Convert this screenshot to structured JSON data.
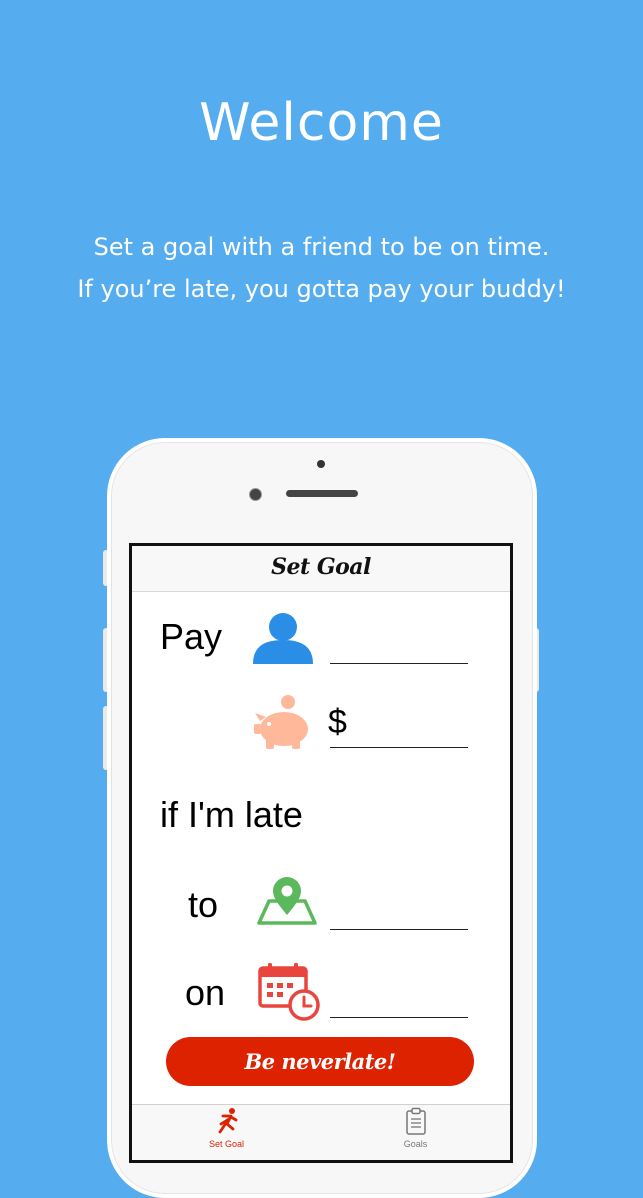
{
  "headline": "Welcome",
  "subtitle": {
    "line1": "Set a goal with a friend to be on time.",
    "line2": "If you’re late, you gotta pay your buddy!"
  },
  "app": {
    "nav_title": "Set Goal",
    "form": {
      "pay_label": "Pay",
      "currency_symbol": "$",
      "late_label": "if I'm late",
      "to_label": "to",
      "on_label": "on"
    },
    "cta_label": "Be neverlate!",
    "tabs": [
      {
        "label": "Set Goal",
        "icon": "running-person-icon",
        "active": true
      },
      {
        "label": "Goals",
        "icon": "clipboard-icon",
        "active": false
      }
    ]
  },
  "colors": {
    "background": "#55acee",
    "accent": "#dd2200",
    "person_icon": "#2b8ee6",
    "piggy_icon": "#ffb89a",
    "location_icon": "#5cb85c",
    "calendar_icon": "#e8453c"
  }
}
